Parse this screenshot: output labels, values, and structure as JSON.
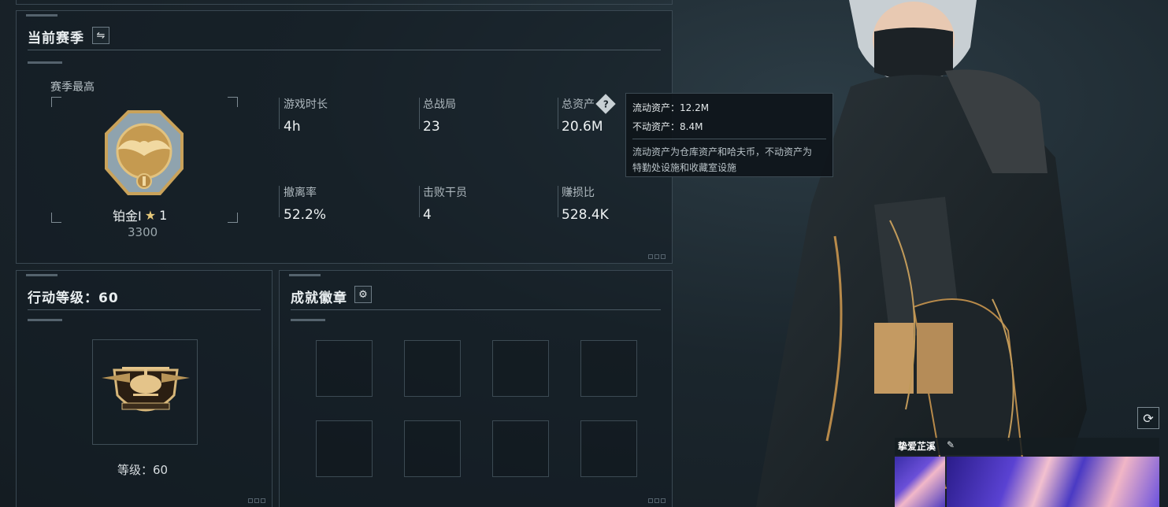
{
  "season_panel": {
    "title": "当前赛季",
    "season_best_label": "赛季最高",
    "rank_name": "铂金I",
    "rank_stars": "1",
    "rank_points": "3300",
    "stats": [
      {
        "label": "游戏时长",
        "value": "4h"
      },
      {
        "label": "总战局",
        "value": "23"
      },
      {
        "label": "总资产",
        "value": "20.6M"
      },
      {
        "label": "撤离率",
        "value": "52.2%"
      },
      {
        "label": "击败干员",
        "value": "4"
      },
      {
        "label": "赚损比",
        "value": "528.4K"
      }
    ]
  },
  "tooltip": {
    "liquid_assets": "流动资产：12.2M",
    "fixed_assets": "不动资产：8.4M",
    "description_line1": "流动资产为仓库资产和哈夫币，不动资产为",
    "description_line2": "特勤处设施和收藏室设施"
  },
  "action_level_panel": {
    "title": "行动等级：60",
    "level_text": "等级：60"
  },
  "achievement_panel": {
    "title": "成就徽章"
  },
  "character": {
    "name": "挚爱芷溪"
  },
  "colors": {
    "panel_border": "#3a4852",
    "gold": "#c49a4d",
    "text": "#eef2f3"
  }
}
